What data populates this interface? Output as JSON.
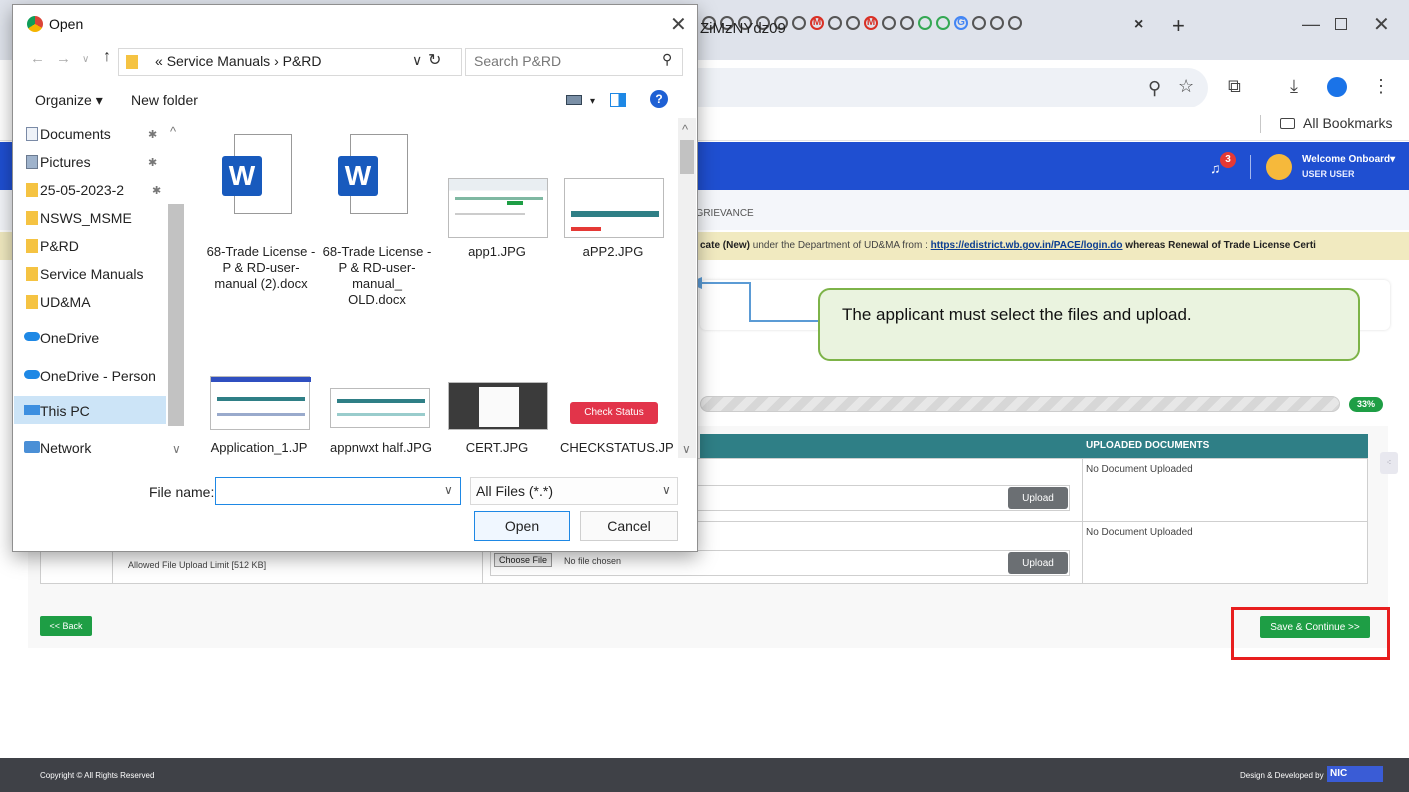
{
  "browser": {
    "url_fragment": "ZiMzNYdz09",
    "bookmarks_label": "All Bookmarks",
    "tab_close": "×",
    "new_tab": "+"
  },
  "site": {
    "welcome": "Welcome Onboard",
    "user": "USER USER",
    "notification_count": "3",
    "breadcrumb": "/ GRIEVANCE",
    "notice_start": "cate (New)",
    "notice_mid": " under the Department of UD&MA from : ",
    "notice_link": "https://edistrict.wb.gov.in/PACE/login.do",
    "notice_end": " whereas Renewal of Trade License Certi",
    "progress_label": "33%",
    "progress_value": 0.33,
    "table_header": "UPLOADED DOCUMENTS",
    "no_document_1": "No Document Uploaded",
    "no_document_2": "No Document Uploaded",
    "upload_label": "Upload",
    "choose_file": "Choose File",
    "no_file_chosen": "No file chosen",
    "file_limit": "Allowed File Upload Limit [512 KB]",
    "back_label": "<< Back",
    "save_label": "Save & Continue >>",
    "footer_left": "Copyright © All Rights Reserved",
    "footer_right": "Design & Developed by",
    "nic_logo": "NIC"
  },
  "callout": {
    "text": "The applicant must select the files and upload."
  },
  "dialog": {
    "title": "Open",
    "path_prefix": "«",
    "path": "Service Manuals  ›  P&RD",
    "search_placeholder": "Search P&RD",
    "organize": "Organize ▾",
    "new_folder": "New folder",
    "nav_items": [
      "Documents",
      "Pictures",
      "25-05-2023-2",
      "NSWS_MSME",
      "P&RD",
      "Service Manuals",
      "UD&MA",
      "OneDrive",
      "OneDrive - Person",
      "This PC",
      "Network"
    ],
    "files": [
      {
        "name": "68-Trade License - P & RD-user-manual (2).docx"
      },
      {
        "name": "68-Trade License - P & RD-user-manual_ OLD.docx"
      },
      {
        "name": "app1.JPG"
      },
      {
        "name": "aPP2.JPG"
      },
      {
        "name": "Application_1.JP"
      },
      {
        "name": "appnwxt half.JPG"
      },
      {
        "name": "CERT.JPG"
      },
      {
        "name": "CHECKSTATUS.JP"
      }
    ],
    "check_status_badge": "Check Status",
    "file_name_label": "File name:",
    "file_name_value": "",
    "file_type": "All Files (*.*)",
    "open_label": "Open",
    "cancel_label": "Cancel"
  }
}
